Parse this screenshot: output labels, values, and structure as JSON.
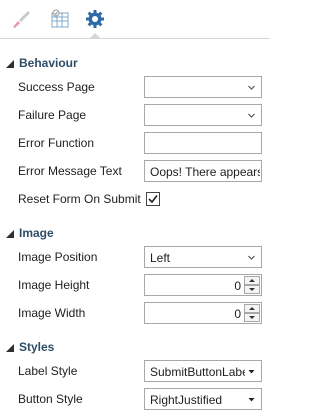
{
  "tabs": [
    {
      "name": "brush-tab",
      "icon": "paintbrush-icon"
    },
    {
      "name": "form-tab",
      "icon": "form-grid-icon"
    },
    {
      "name": "settings-tab",
      "icon": "gear-icon",
      "active": true
    }
  ],
  "behaviour": {
    "title": "Behaviour",
    "success_page": {
      "label": "Success Page",
      "value": ""
    },
    "failure_page": {
      "label": "Failure Page",
      "value": ""
    },
    "error_function": {
      "label": "Error Function",
      "value": ""
    },
    "error_message_text": {
      "label": "Error Message Text",
      "value": "Oops! There appears to"
    },
    "reset_form_on_submit": {
      "label": "Reset Form On Submit",
      "checked": true
    }
  },
  "image": {
    "title": "Image",
    "position": {
      "label": "Image Position",
      "value": "Left"
    },
    "height": {
      "label": "Image Height",
      "value": "0"
    },
    "width": {
      "label": "Image Width",
      "value": "0"
    }
  },
  "styles": {
    "title": "Styles",
    "label_style": {
      "label": "Label Style",
      "value": "SubmitButtonLabel"
    },
    "button_style": {
      "label": "Button Style",
      "value": "RightJustified"
    }
  },
  "colors": {
    "section_header": "#2e4d67",
    "border": "#a8a8a8",
    "accent_blue": "#2f6aa6"
  }
}
